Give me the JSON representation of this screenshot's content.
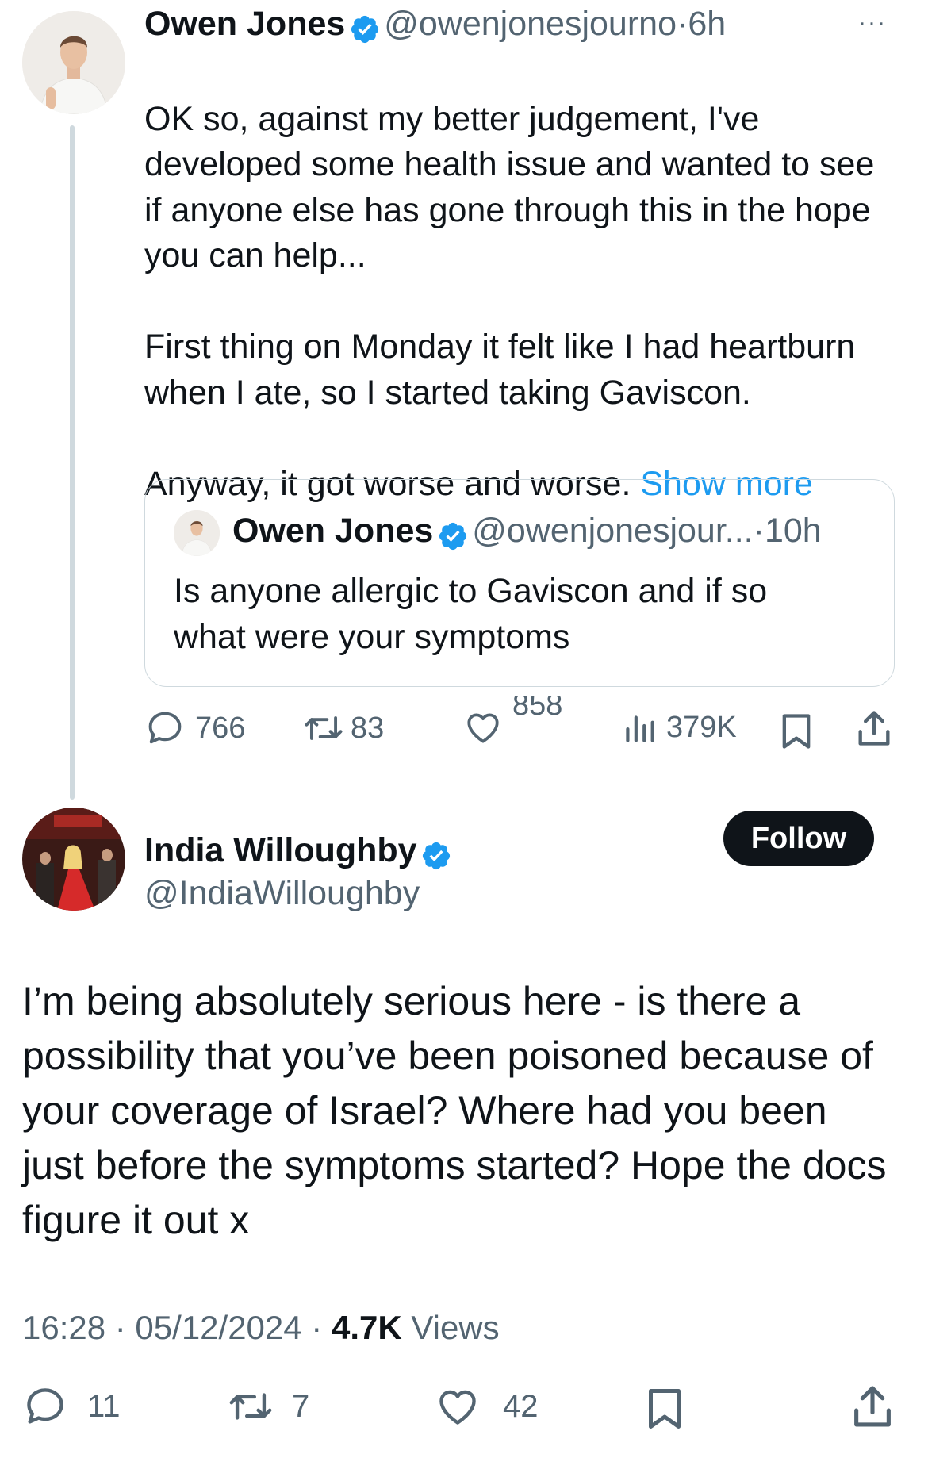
{
  "parent_tweet": {
    "author_name": "Owen Jones",
    "handle": "@owenjonesjourno",
    "separator": "·",
    "time": "6h",
    "text_main": "OK so, against my better judgement, I've developed some health issue and wanted to see if anyone else has gone through this in the hope you can help...\n\nFirst thing on Monday it felt like I had heartburn when I ate, so I started taking Gaviscon.\n\nAnyway, it got worse and worse.",
    "show_more": "Show more",
    "more_menu": "···",
    "quote": {
      "author_name": "Owen Jones",
      "handle": "@owenjonesjour...",
      "separator": "·",
      "time": "10h",
      "text": "Is anyone allergic to Gaviscon and if so what were your symptoms"
    },
    "metrics": {
      "replies": "766",
      "reposts": "83",
      "likes": "858",
      "views": "379K"
    }
  },
  "reply_tweet": {
    "author_name": "India Willoughby",
    "handle": "@IndiaWilloughby",
    "follow_label": "Follow",
    "text": "I’m being absolutely serious here - is there a possibility that you’ve been poisoned because of your coverage of Israel? Where had you been just before the symptoms started? Hope the docs figure it out x",
    "timestamp": "16:28 · 05/12/2024 ·",
    "views_count": "4.7K",
    "views_label": "Views",
    "metrics": {
      "replies": "11",
      "reposts": "7",
      "likes": "42"
    }
  },
  "colors": {
    "accent": "#1d9bf0",
    "text": "#0f1419",
    "secondary": "#536471",
    "border": "#cfd9de"
  }
}
